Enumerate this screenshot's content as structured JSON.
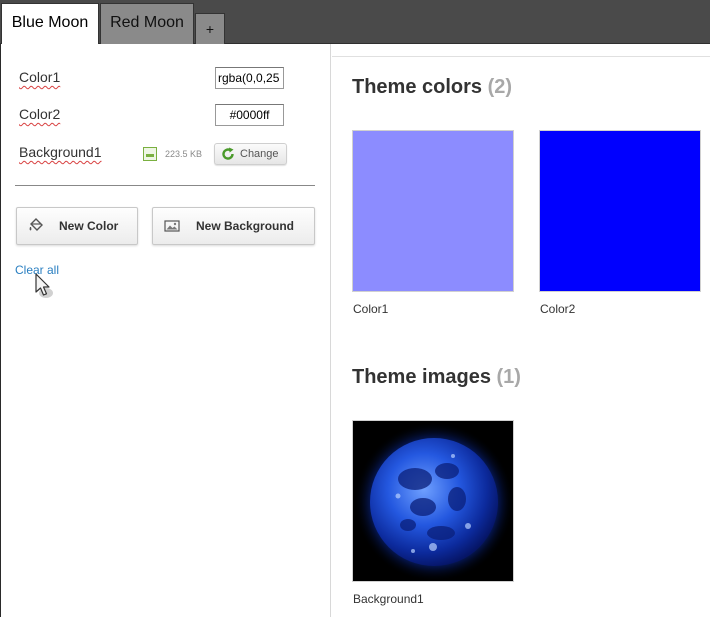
{
  "tabs": {
    "active": "Blue Moon",
    "inactive": "Red Moon",
    "add": "+"
  },
  "editor": {
    "color1": {
      "label": "Color1",
      "value": "rgba(0,0,25"
    },
    "color2": {
      "label": "Color2",
      "value": "#0000ff"
    },
    "background1": {
      "label": "Background1",
      "file_size": "223.5 KB",
      "change_label": "Change"
    },
    "new_color_label": "New Color",
    "new_background_label": "New Background",
    "clear_all_label": "Clear all"
  },
  "preview": {
    "colors_heading": "Theme colors",
    "colors_count": "(2)",
    "swatches": [
      {
        "label": "Color1",
        "color": "#8c8cff"
      },
      {
        "label": "Color2",
        "color": "#0000ff"
      }
    ],
    "images_heading": "Theme images",
    "images_count": "(1)",
    "images": [
      {
        "label": "Background1"
      }
    ]
  },
  "icons": {
    "file": "image-file-icon",
    "refresh": "refresh-icon",
    "paint": "paint-bucket-icon",
    "picture": "picture-icon",
    "cursor": "mouse-cursor-icon"
  }
}
